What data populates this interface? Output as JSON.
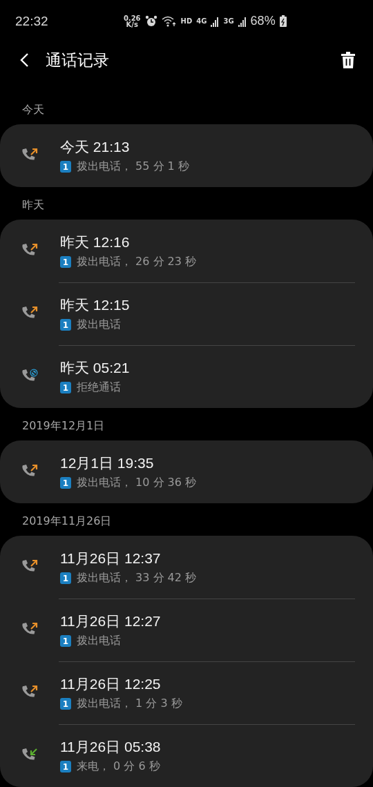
{
  "status_bar": {
    "time": "22:32",
    "speed_value": "0.26",
    "speed_unit": "K/s",
    "hd": "HD",
    "network_1": "4G",
    "network_2": "3G",
    "battery": "68%"
  },
  "header": {
    "title": "通话记录"
  },
  "sections": [
    {
      "heading": "今天",
      "calls": [
        {
          "kind": "outgoing",
          "time": "今天 21:13",
          "sim": "1",
          "detail": "拨出电话， 55 分 1 秒"
        }
      ]
    },
    {
      "heading": "昨天",
      "calls": [
        {
          "kind": "outgoing",
          "time": "昨天 12:16",
          "sim": "1",
          "detail": "拨出电话， 26 分 23 秒"
        },
        {
          "kind": "outgoing",
          "time": "昨天 12:15",
          "sim": "1",
          "detail": "拨出电话"
        },
        {
          "kind": "rejected",
          "time": "昨天 05:21",
          "sim": "1",
          "detail": "拒绝通话"
        }
      ]
    },
    {
      "heading": "2019年12月1日",
      "calls": [
        {
          "kind": "outgoing",
          "time": "12月1日 19:35",
          "sim": "1",
          "detail": "拨出电话， 10 分 36 秒"
        }
      ]
    },
    {
      "heading": "2019年11月26日",
      "calls": [
        {
          "kind": "outgoing",
          "time": "11月26日 12:37",
          "sim": "1",
          "detail": "拨出电话， 33 分 42 秒"
        },
        {
          "kind": "outgoing",
          "time": "11月26日 12:27",
          "sim": "1",
          "detail": "拨出电话"
        },
        {
          "kind": "outgoing",
          "time": "11月26日 12:25",
          "sim": "1",
          "detail": "拨出电话， 1 分 3 秒"
        },
        {
          "kind": "incoming",
          "time": "11月26日 05:38",
          "sim": "1",
          "detail": "来电， 0 分 6 秒"
        }
      ]
    }
  ]
}
